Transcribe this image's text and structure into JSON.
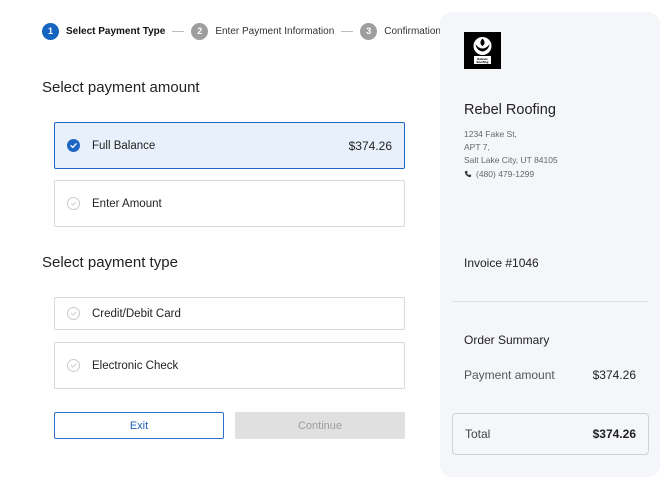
{
  "stepper": {
    "steps": [
      {
        "num": "1",
        "label": "Select Payment Type"
      },
      {
        "num": "2",
        "label": "Enter Payment Information"
      },
      {
        "num": "3",
        "label": "Confirmation"
      }
    ]
  },
  "amount_section": {
    "title": "Select payment amount",
    "options": [
      {
        "label": "Full Balance",
        "amount": "$374.26"
      },
      {
        "label": "Enter Amount"
      }
    ]
  },
  "type_section": {
    "title": "Select payment type",
    "options": [
      {
        "label": "Credit/Debit Card"
      },
      {
        "label": "Electronic Check"
      }
    ]
  },
  "buttons": {
    "exit": "Exit",
    "continue": "Continue"
  },
  "panel": {
    "logo_text": "Rebels Roofing",
    "company": "Rebel Roofing",
    "address_line1": "1234 Fake St,",
    "address_line2": "APT 7,",
    "address_line3": "Salt Lake City, UT 84105",
    "phone": "(480) 479-1299",
    "invoice": "Invoice #1046",
    "summary_title": "Order Summary",
    "payment_label": "Payment amount",
    "payment_value": "$374.26",
    "total_label": "Total",
    "total_value": "$374.26"
  },
  "colors": {
    "accent": "#1e66c4",
    "selected_bg": "#e8f1fb",
    "panel_bg": "#f4f6f9",
    "disabled_bg": "#e0e0e0"
  },
  "icons": {
    "check": "check-circle-icon",
    "unchecked": "check-circle-outline-icon",
    "phone": "phone-icon",
    "logo": "rebel-logo-icon"
  }
}
